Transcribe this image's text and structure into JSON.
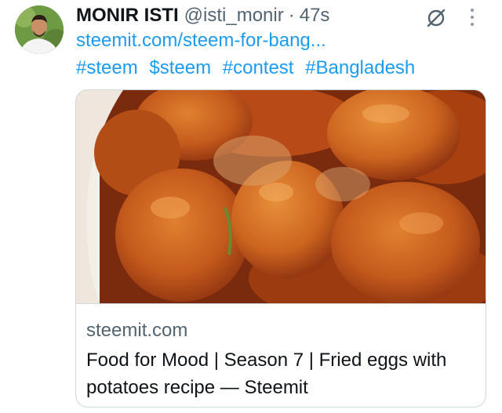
{
  "tweet": {
    "author_name": "MONIR ISTI",
    "author_handle": "@isti_monir",
    "separator": "·",
    "timestamp": "47s",
    "link_text": "steemit.com/steem-for-bang...",
    "hashtags": [
      "#steem",
      "$steem",
      "#contest",
      "#Bangladesh"
    ]
  },
  "card": {
    "domain": "steemit.com",
    "title": "Food for Mood | Season 7 | Fried eggs with potatoes recipe — Steemit"
  },
  "icons": {
    "mute": "mute-icon",
    "more": "more-vertical-icon"
  },
  "colors": {
    "link": "#1d9bf0",
    "secondary_text": "#536471",
    "primary_text": "#0f1419",
    "border": "#cfd9de"
  }
}
